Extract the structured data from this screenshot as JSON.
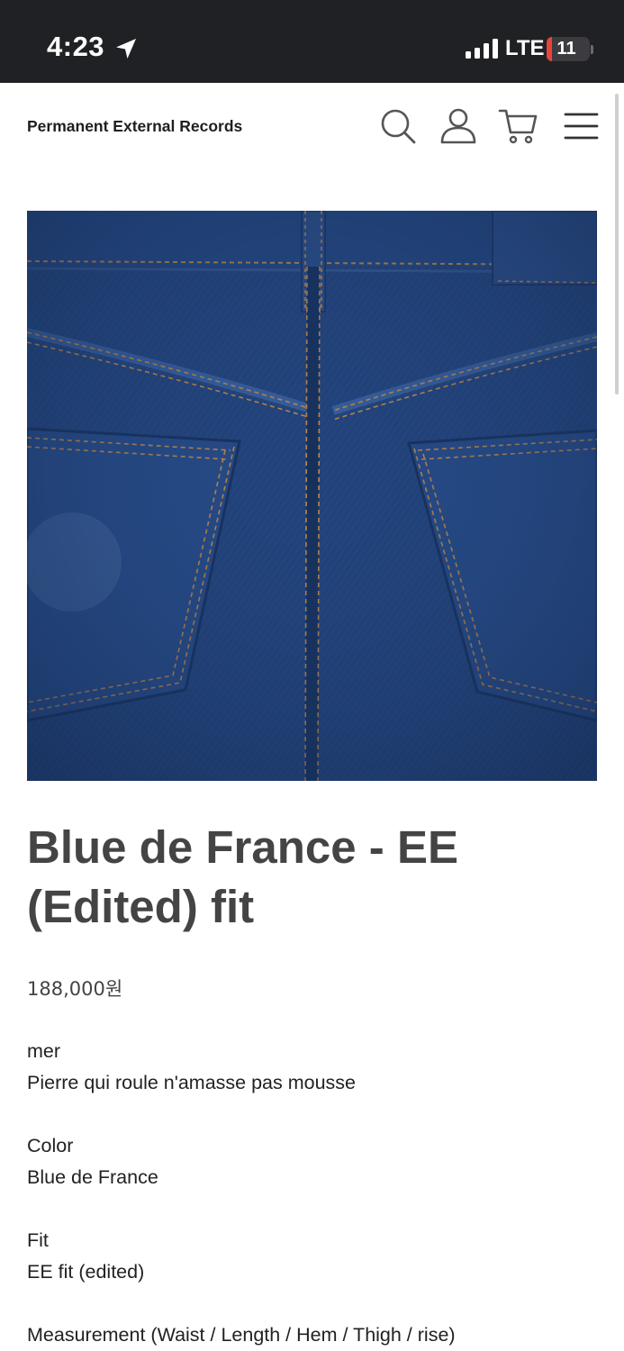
{
  "status_bar": {
    "time": "4:23",
    "network": "LTE",
    "battery": "11",
    "battery_level": 0.11
  },
  "header": {
    "site_title": "Permanent External Records",
    "icons": [
      "search-icon",
      "user-icon",
      "cart-icon",
      "menu-icon"
    ]
  },
  "product": {
    "title": "Blue de France - EE (Edited) fit",
    "price": "188,000원",
    "image_subject": "denim-back-pockets-photo",
    "colors": {
      "denim": "#1f3f74",
      "stitch": "#c48a45",
      "title_text": "#444444"
    },
    "details": [
      {
        "label": "mer",
        "value": "Pierre qui roule n'amasse pas mousse"
      },
      {
        "label": "Color",
        "value": "Blue de France"
      },
      {
        "label": "Fit",
        "value": "EE fit (edited)"
      },
      {
        "label": "Measurement (Waist / Length / Hem / Thigh / rise)"
      }
    ]
  }
}
